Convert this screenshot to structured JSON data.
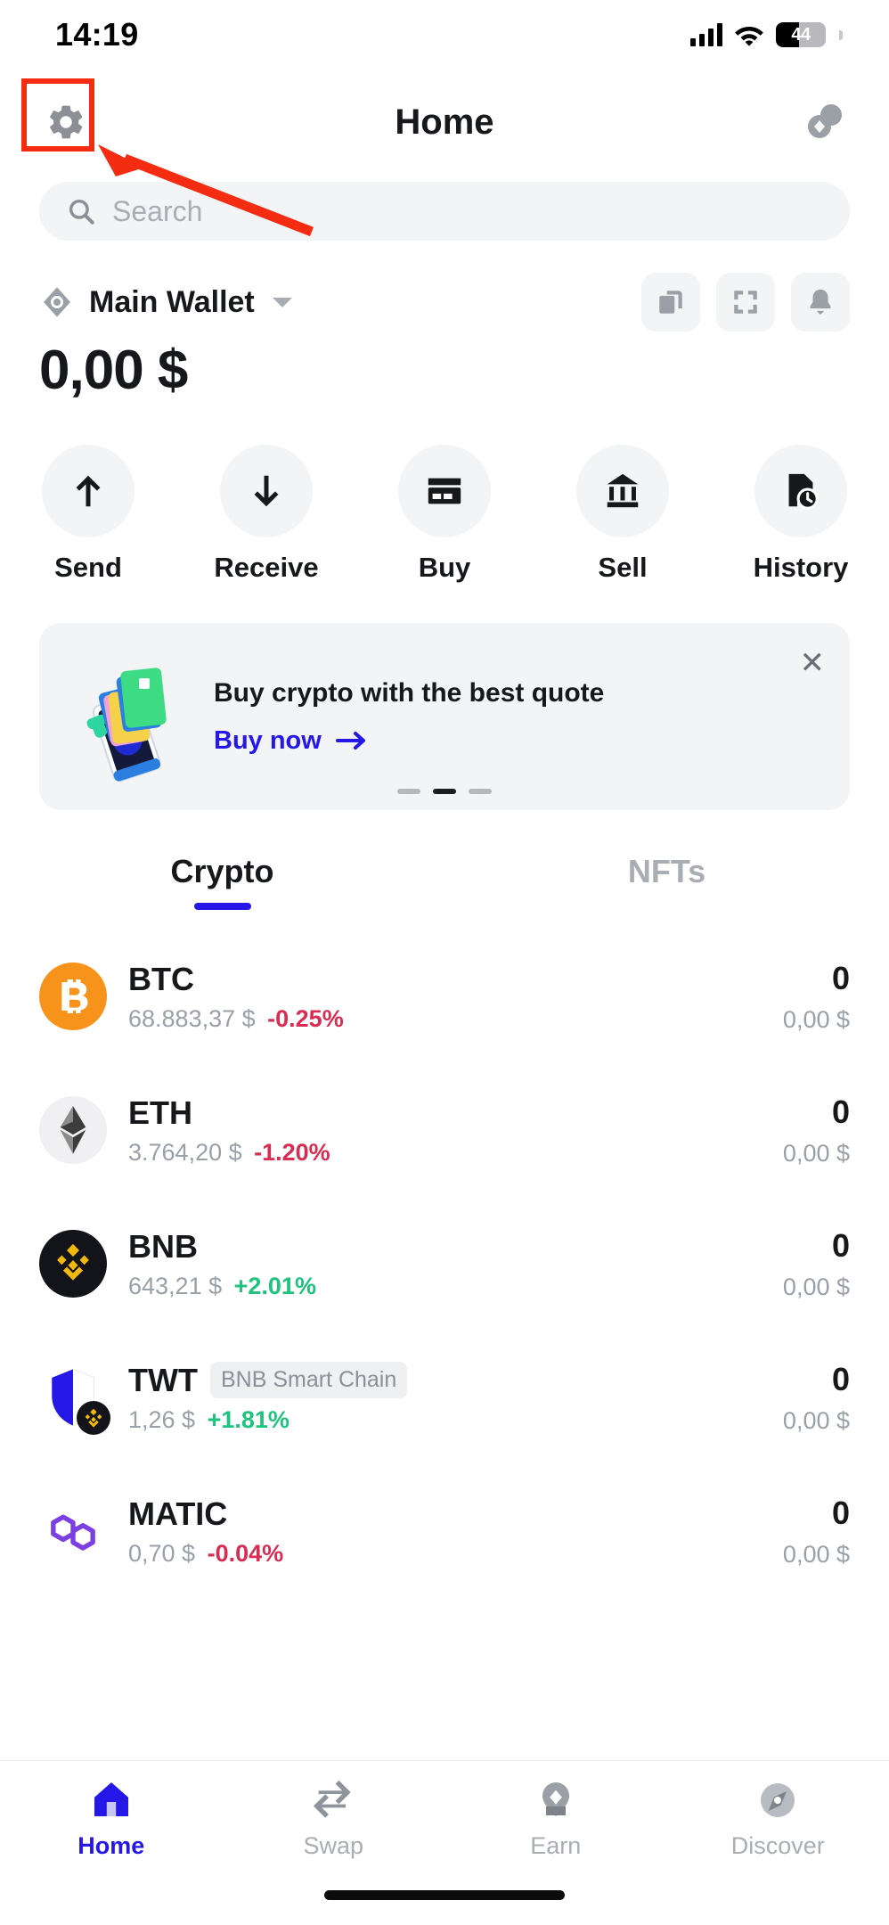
{
  "status_bar": {
    "time": "14:19",
    "battery_level": "44",
    "icons": [
      "signal-bars-icon",
      "wifi-icon",
      "battery-icon"
    ]
  },
  "header": {
    "title": "Home",
    "settings_icon": "gear-icon",
    "right_icon": "tokens-icon"
  },
  "annotation": {
    "highlight_target": "settings-gear-button",
    "color": "#f42d12"
  },
  "search": {
    "placeholder": "Search",
    "value": "",
    "icon": "search-icon"
  },
  "wallet": {
    "eye_icon": "eye-icon",
    "name": "Main Wallet",
    "caret_icon": "chevron-down-icon",
    "balance": "0,00 $",
    "actions": [
      {
        "name": "copy-address-button",
        "icon": "copy-icon"
      },
      {
        "name": "scan-qr-button",
        "icon": "scan-icon"
      },
      {
        "name": "notifications-button",
        "icon": "bell-icon"
      }
    ]
  },
  "quick_actions": [
    {
      "label": "Send",
      "icon": "arrow-up-icon"
    },
    {
      "label": "Receive",
      "icon": "arrow-down-icon"
    },
    {
      "label": "Buy",
      "icon": "credit-card-icon"
    },
    {
      "label": "Sell",
      "icon": "bank-icon"
    },
    {
      "label": "History",
      "icon": "history-clock-icon"
    }
  ],
  "promo": {
    "title": "Buy crypto with the best quote",
    "cta": "Buy now",
    "cta_arrow": "arrow-right-icon",
    "close_icon": "close-icon",
    "dots_total": 3,
    "dots_active_index": 1,
    "art": "crypto-cards-phone-illustration"
  },
  "tabs": [
    {
      "label": "Crypto",
      "active": true
    },
    {
      "label": "NFTs",
      "active": false
    }
  ],
  "assets": {
    "columns": [
      "asset",
      "price_and_change",
      "amount",
      "value"
    ],
    "rows": [
      {
        "symbol": "BTC",
        "badge": "",
        "price": "68.883,37 $",
        "change": "-0.25%",
        "direction": "down",
        "amount": "0",
        "value": "0,00 $",
        "icon": "bitcoin-icon"
      },
      {
        "symbol": "ETH",
        "badge": "",
        "price": "3.764,20 $",
        "change": "-1.20%",
        "direction": "down",
        "amount": "0",
        "value": "0,00 $",
        "icon": "ethereum-icon"
      },
      {
        "symbol": "BNB",
        "badge": "",
        "price": "643,21 $",
        "change": "+2.01%",
        "direction": "up",
        "amount": "0",
        "value": "0,00 $",
        "icon": "bnb-icon"
      },
      {
        "symbol": "TWT",
        "badge": "BNB Smart Chain",
        "price": "1,26 $",
        "change": "+1.81%",
        "direction": "up",
        "amount": "0",
        "value": "0,00 $",
        "icon": "trust-wallet-token-icon"
      },
      {
        "symbol": "MATIC",
        "badge": "",
        "price": "0,70 $",
        "change": "-0.04%",
        "direction": "down",
        "amount": "0",
        "value": "0,00 $",
        "icon": "polygon-icon"
      }
    ]
  },
  "bottom_nav": [
    {
      "label": "Home",
      "icon": "home-icon",
      "active": true
    },
    {
      "label": "Swap",
      "icon": "swap-arrows-icon",
      "active": false
    },
    {
      "label": "Earn",
      "icon": "earn-icon",
      "active": false
    },
    {
      "label": "Discover",
      "icon": "compass-icon",
      "active": false
    }
  ],
  "colors": {
    "accent": "#2417e8",
    "up": "#1fc37e",
    "down": "#d92c52",
    "surface": "#f3f4f6",
    "annotation": "#f42d12"
  }
}
